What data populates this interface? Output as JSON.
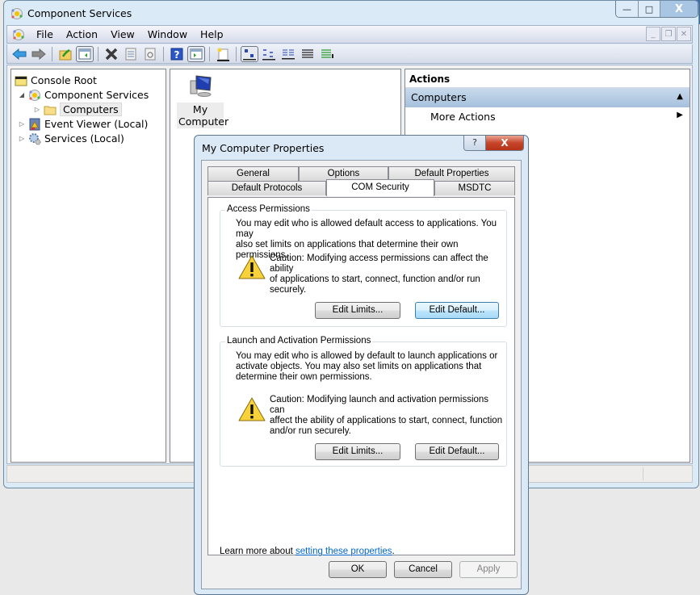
{
  "window": {
    "title": "Component Services",
    "caption": {
      "minimize": "—",
      "maximize": "□",
      "close": "X"
    }
  },
  "menu": {
    "items": [
      "File",
      "Action",
      "View",
      "Window",
      "Help"
    ],
    "mdi": {
      "minimize": "_",
      "restore": "❐",
      "close": "✕"
    }
  },
  "toolbar": {
    "buttons": [
      "back",
      "forward",
      "up-folder",
      "show-hide-console-tree",
      "delete",
      "properties",
      "refresh",
      "help",
      "show-hide-action-pane",
      "new",
      "large-icons",
      "small-icons",
      "list",
      "detail",
      "configure"
    ]
  },
  "tree": {
    "items": [
      {
        "label": "Console Root",
        "icon": "folder-icon",
        "level": 0
      },
      {
        "label": "Component Services",
        "icon": "component-services-icon",
        "level": 1,
        "expanded": true
      },
      {
        "label": "Computers",
        "icon": "folder-icon",
        "level": 2,
        "selected": true
      },
      {
        "label": "Event Viewer (Local)",
        "icon": "event-viewer-icon",
        "level": 1
      },
      {
        "label": "Services (Local)",
        "icon": "services-icon",
        "level": 1
      }
    ]
  },
  "middle": {
    "items": [
      {
        "label": "My Computer",
        "icon": "computer-icon"
      }
    ]
  },
  "actions": {
    "header": "Actions",
    "group": "Computers",
    "items": [
      {
        "label": "More Actions"
      }
    ]
  },
  "dialog": {
    "title": "My Computer Properties",
    "help": "?",
    "close": "X",
    "tabs_row1": [
      "General",
      "Options",
      "Default Properties"
    ],
    "tabs_row2": [
      "Default Protocols",
      "COM Security",
      "MSDTC"
    ],
    "active_tab": "COM Security",
    "access": {
      "title": "Access Permissions",
      "desc_lines": [
        "You may edit who is allowed default access to applications. You may",
        "also set limits on applications that determine their own permissions."
      ],
      "caution_lines": [
        "Caution: Modifying access permissions can affect the ability",
        "of applications to start, connect, function and/or run",
        "securely."
      ],
      "edit_limits": "Edit Limits...",
      "edit_default": "Edit Default..."
    },
    "launch": {
      "title": "Launch and Activation Permissions",
      "desc_lines": [
        "You may edit who is allowed by default to launch applications or",
        "activate objects. You may also set limits on applications that",
        "determine their own permissions."
      ],
      "caution_lines": [
        "Caution: Modifying launch and activation permissions can",
        "affect the ability of applications to start, connect, function",
        "and/or run securely."
      ],
      "edit_limits": "Edit Limits...",
      "edit_default": "Edit Default..."
    },
    "learn_prefix": "Learn more about ",
    "learn_link": "setting these properties",
    "learn_suffix": ".",
    "ok": "OK",
    "cancel": "Cancel",
    "apply": "Apply"
  },
  "colors": {
    "link": "#0066cc",
    "actions_group_bg": "#b7cde4",
    "close_red": "#c7452b"
  }
}
